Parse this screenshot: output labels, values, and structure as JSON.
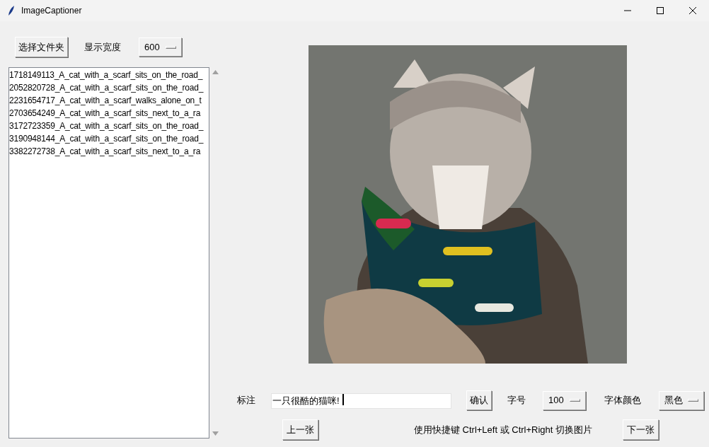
{
  "window": {
    "title": "ImageCaptioner"
  },
  "toolbar": {
    "folder_button": "选择文件夹",
    "width_label": "显示宽度",
    "width_menu": "600"
  },
  "files": [
    {
      "name": "1718149113_A_cat_with_a_scarf_sits_on_the_road_",
      "selected": false
    },
    {
      "name": "2052820728_A_cat_with_a_scarf_sits_on_the_road_",
      "selected": false
    },
    {
      "name": "2231654717_A_cat_with_a_scarf_walks_alone_on_t",
      "selected": false
    },
    {
      "name": "2703654249_A_cat_with_a_scarf_sits_next_to_a_ra",
      "selected": false
    },
    {
      "name": "3172723359_A_cat_with_a_scarf_sits_on_the_road_",
      "selected": false
    },
    {
      "name": "3190948144_A_cat_with_a_scarf_sits_on_the_road_",
      "selected": false
    },
    {
      "name": "3382272738_A_cat_with_a_scarf_sits_next_to_a_ra",
      "selected": false
    }
  ],
  "caption": {
    "label": "标注",
    "value": "一只很酷的猫咪!",
    "confirm_button": "确认",
    "size_label": "字号",
    "size_menu": "100",
    "color_label": "字体颜色",
    "color_menu": "黑色"
  },
  "navigation": {
    "prev_button": "上一张",
    "hint": "使用快捷键 Ctrl+Left 或 Ctrl+Right 切换图片",
    "next_button": "下一张"
  }
}
